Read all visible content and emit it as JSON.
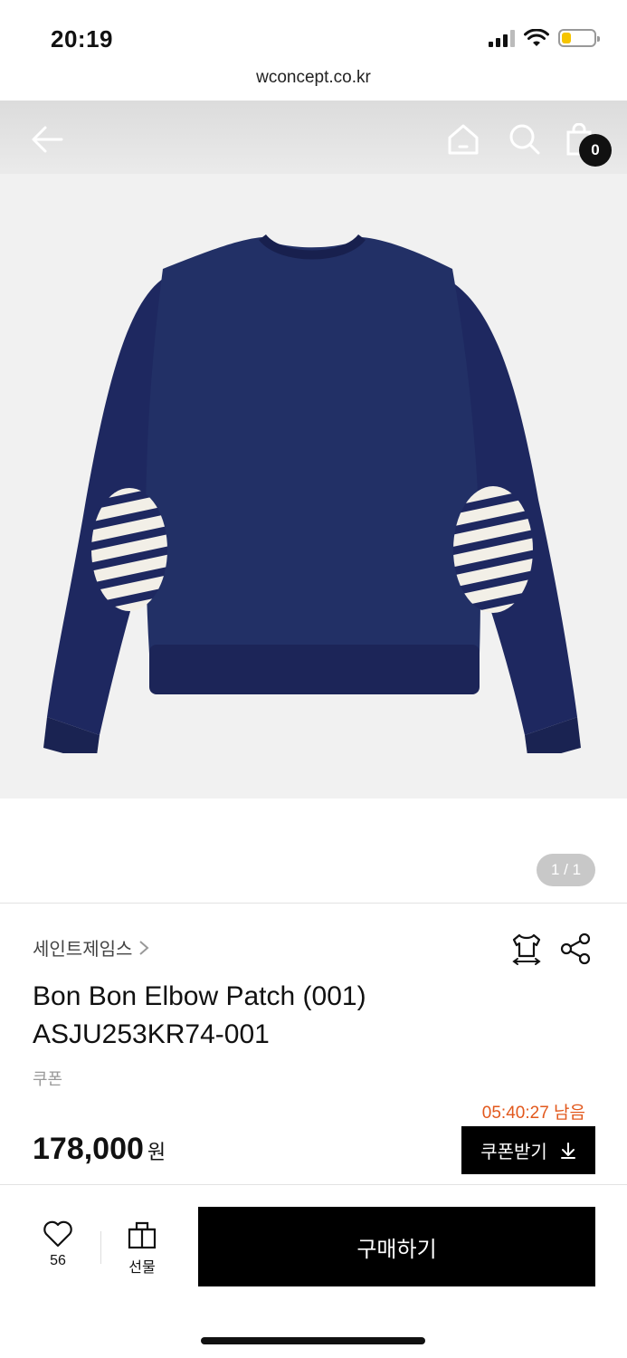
{
  "status_bar": {
    "time": "20:19",
    "icons": [
      "signal-icon",
      "wifi-icon",
      "battery-icon"
    ],
    "battery_level": 0.3
  },
  "browser": {
    "url": "wconcept.co.kr"
  },
  "nav": {
    "icons": [
      "back-arrow-icon",
      "home-icon",
      "search-icon",
      "shopping-bag-icon"
    ],
    "cart_count": "0"
  },
  "gallery": {
    "pager": "1 / 1"
  },
  "product": {
    "brand": "세인트제임스",
    "name_line1": "Bon Bon Elbow Patch (001)",
    "name_line2": "ASJU253KR74-001",
    "coupon_label": "쿠폰",
    "timer": "05:40:27 남음",
    "price": "178,000",
    "price_unit": "원",
    "coupon_button": "쿠폰받기"
  },
  "bottom_bar": {
    "like_count": "56",
    "gift_label": "선물",
    "buy_label": "구매하기"
  },
  "colors": {
    "accent": "#000000",
    "timer": "#e2581c",
    "sweater": "#1e2860",
    "patch_stripe": "#1e2860",
    "patch_base": "#f2efe7"
  }
}
